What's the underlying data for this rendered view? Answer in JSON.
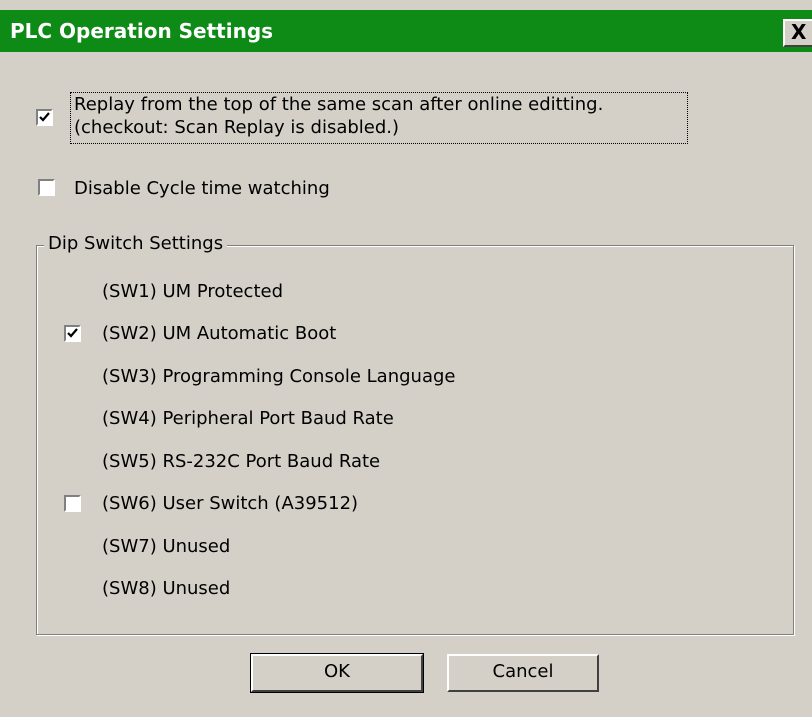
{
  "window": {
    "title": "PLC Operation Settings",
    "close_glyph": "X"
  },
  "options": {
    "replay": {
      "checked": true,
      "line1": "Replay from the top of the same scan after online editting.",
      "line2": "(checkout: Scan Replay is disabled.)"
    },
    "cycle": {
      "checked": false,
      "label": "Disable Cycle time watching"
    }
  },
  "dip": {
    "legend": "Dip Switch Settings",
    "items": [
      {
        "label": "(SW1) UM Protected",
        "checkbox": false,
        "checked": false
      },
      {
        "label": "(SW2) UM Automatic Boot",
        "checkbox": true,
        "checked": true
      },
      {
        "label": "(SW3) Programming Console Language",
        "checkbox": false,
        "checked": false
      },
      {
        "label": "(SW4) Peripheral Port Baud Rate",
        "checkbox": false,
        "checked": false
      },
      {
        "label": "(SW5) RS-232C Port Baud Rate",
        "checkbox": false,
        "checked": false
      },
      {
        "label": "(SW6) User Switch (A39512)",
        "checkbox": true,
        "checked": false
      },
      {
        "label": "(SW7) Unused",
        "checkbox": false,
        "checked": false
      },
      {
        "label": "(SW8) Unused",
        "checkbox": false,
        "checked": false
      }
    ]
  },
  "buttons": {
    "ok": "OK",
    "cancel": "Cancel"
  }
}
